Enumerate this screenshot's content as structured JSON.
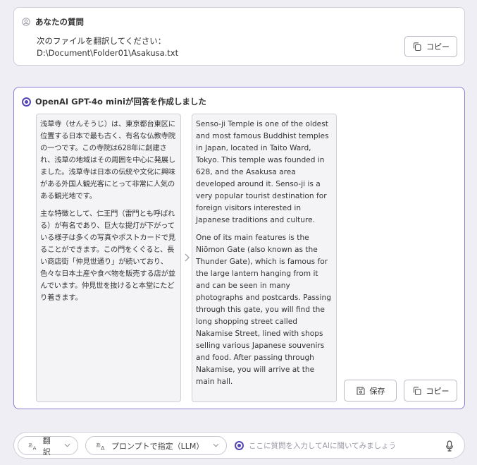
{
  "question": {
    "header": "あなたの質問",
    "lines": [
      "次のファイルを翻訳してください：",
      "D:\\Document\\Folder01\\Asakusa.txt"
    ],
    "copy_label": "コピー"
  },
  "answer": {
    "header": "OpenAI GPT-4o miniが回答を作成しました",
    "source_paragraphs": [
      "浅草寺（せんそうじ）は、東京都台東区に位置する日本で最も古く、有名な仏教寺院の一つです。この寺院は628年に創建され、浅草の地域はその周囲を中心に発展しました。浅草寺は日本の伝統や文化に興味がある外国人観光客にとって非常に人気のある観光地です。",
      "主な特徴として、仁王門（雷門とも呼ばれる）が有名であり、巨大な提灯が下がっている様子は多くの写真やポストカードで見ることができます。この門をくぐると、長い商店街「仲見世通り」が続いており、色々な日本土産や食べ物を販売する店が並んでいます。仲見世を抜けると本堂にたどり着きます。"
    ],
    "translated_paragraphs": [
      "Senso-ji Temple is one of the oldest and most famous Buddhist temples in Japan, located in Taito Ward, Tokyo. This temple was founded in 628, and the Asakusa area developed around it. Senso-ji is a very popular tourist destination for foreign visitors interested in Japanese traditions and culture.",
      "One of its main features is the Niōmon Gate (also known as the Thunder Gate), which is famous for the large lantern hanging from it and can be seen in many photographs and postcards. Passing through this gate, you will find the long shopping street called Nakamise Street, lined with shops selling various Japanese souvenirs and food. After passing through Nakamise, you will arrive at the main hall."
    ],
    "save_label": "保存",
    "copy_label": "コピー"
  },
  "input_bar": {
    "translate_label": "翻訳",
    "prompt_label": "プロンプトで指定（LLM）",
    "placeholder": "ここに質問を入力してAIに聞いてみましょう"
  },
  "colors": {
    "accent": "#5447b4",
    "answer_border": "#8b7fd2",
    "background": "#efeef4"
  },
  "icons": {
    "user": "user-circle-icon",
    "copy": "copy-icon",
    "save": "save-icon",
    "mic": "microphone-icon",
    "arrow": "chevron-right-icon",
    "translate": "translate-icon"
  }
}
